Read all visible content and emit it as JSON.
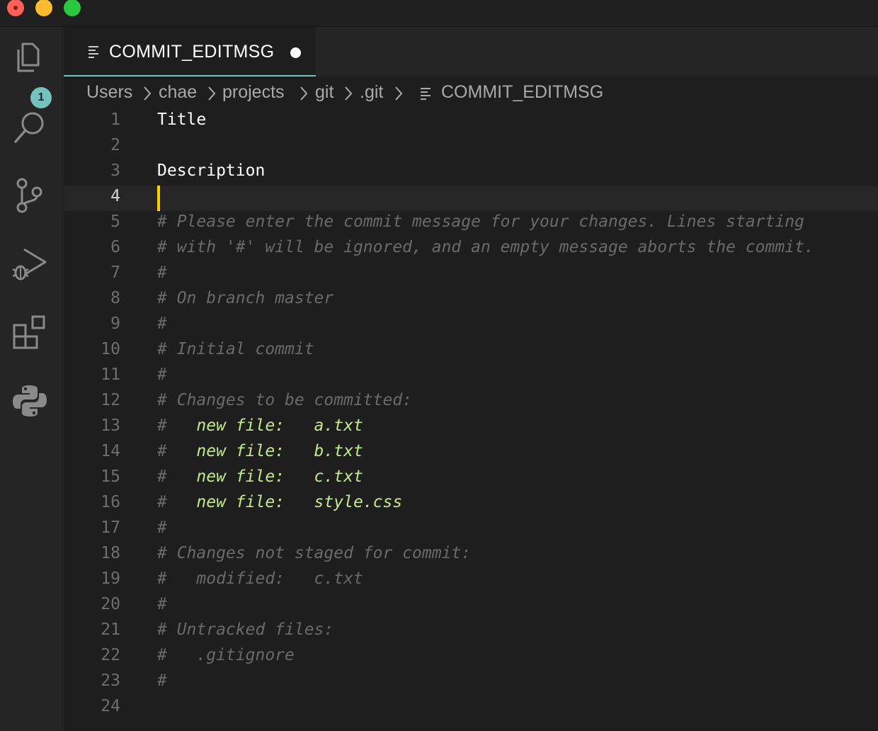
{
  "window": {
    "controls": [
      "close",
      "minimize",
      "maximize"
    ]
  },
  "activity_bar": {
    "explorer_badge": "1",
    "icons": [
      "files-icon",
      "search-icon",
      "source-control-icon",
      "run-debug-icon",
      "extensions-icon",
      "python-icon"
    ]
  },
  "tab": {
    "label": "COMMIT_EDITMSG",
    "dirty": true
  },
  "breadcrumb": {
    "items": [
      "Users",
      "chae",
      "projects",
      "git",
      ".git",
      "COMMIT_EDITMSG"
    ]
  },
  "editor": {
    "current_line": 4,
    "lines": [
      {
        "number": "1",
        "text": "Title"
      },
      {
        "number": "2",
        "text": ""
      },
      {
        "number": "3",
        "text": "Description"
      },
      {
        "number": "4",
        "text": ""
      },
      {
        "number": "5",
        "text": "# Please enter the commit message for your changes. Lines starting"
      },
      {
        "number": "6",
        "text": "# with '#' will be ignored, and an empty message aborts the commit."
      },
      {
        "number": "7",
        "text": "#"
      },
      {
        "number": "8",
        "text": "# On branch master"
      },
      {
        "number": "9",
        "text": "#"
      },
      {
        "number": "10",
        "text": "# Initial commit"
      },
      {
        "number": "11",
        "text": "#"
      },
      {
        "number": "12",
        "text": "# Changes to be committed:"
      },
      {
        "number": "13",
        "prefix": "#   ",
        "text": "new file:   a.txt"
      },
      {
        "number": "14",
        "prefix": "#   ",
        "text": "new file:   b.txt"
      },
      {
        "number": "15",
        "prefix": "#   ",
        "text": "new file:   c.txt"
      },
      {
        "number": "16",
        "prefix": "#   ",
        "text": "new file:   style.css"
      },
      {
        "number": "17",
        "text": "#"
      },
      {
        "number": "18",
        "text": "# Changes not staged for commit:"
      },
      {
        "number": "19",
        "text": "#   modified:   c.txt"
      },
      {
        "number": "20",
        "text": "#"
      },
      {
        "number": "21",
        "text": "# Untracked files:"
      },
      {
        "number": "22",
        "text": "#   .gitignore"
      },
      {
        "number": "23",
        "text": "#"
      },
      {
        "number": "24",
        "text": ""
      }
    ]
  },
  "colors": {
    "accent": "#73c2bd",
    "cursor": "#ffcc00",
    "staged_file": "#c3e88d",
    "comment": "#6a6a6a",
    "editor_bg": "#1e1e1e"
  }
}
